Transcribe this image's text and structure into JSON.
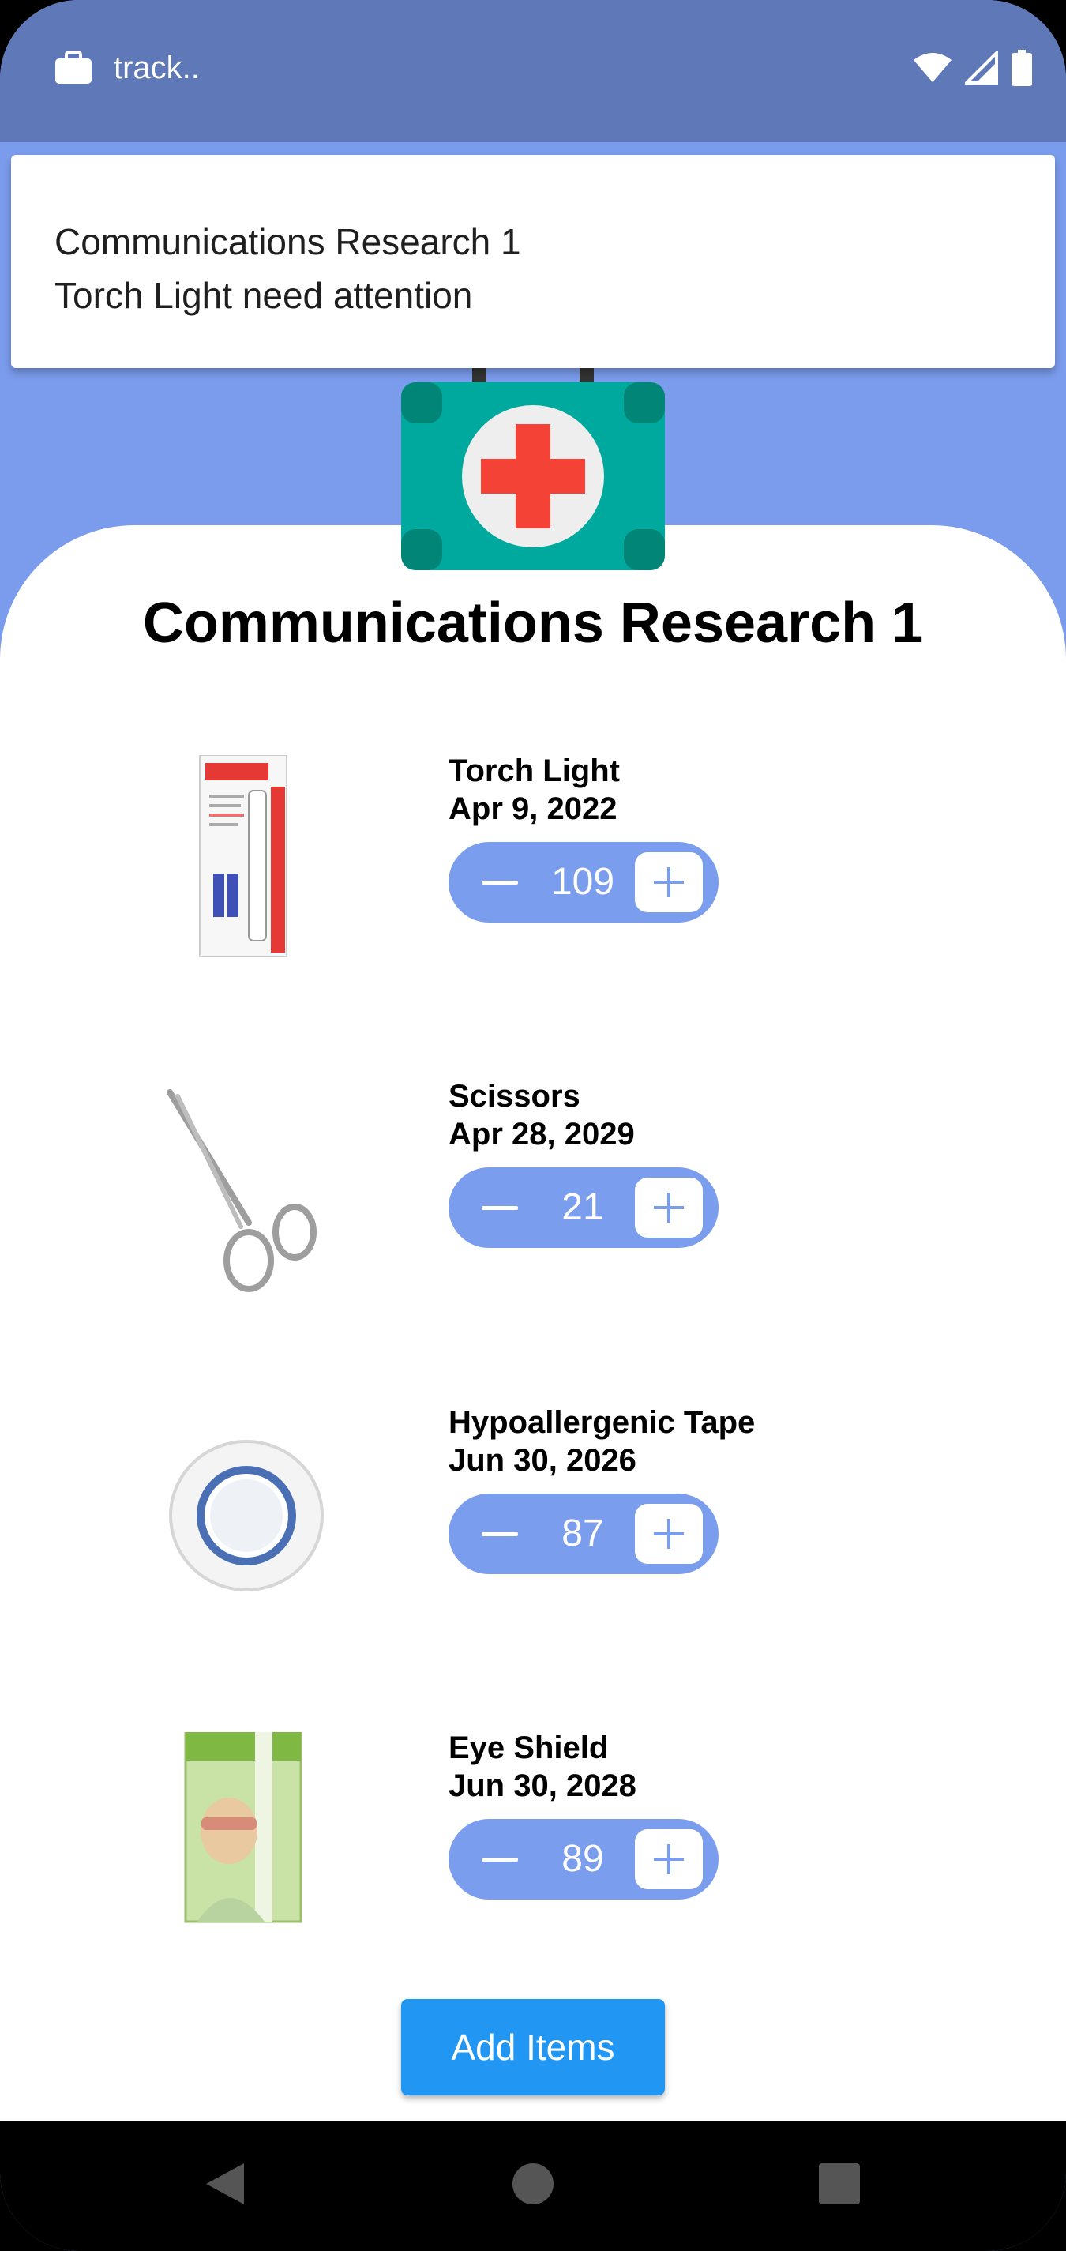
{
  "status_bar": {
    "app_label": "track.."
  },
  "notification": {
    "title": "Communications Research 1",
    "message": "Torch Light need attention"
  },
  "page": {
    "title": "Communications Research 1"
  },
  "items": [
    {
      "name": "Torch Light",
      "date": "Apr 9, 2022",
      "quantity": "109"
    },
    {
      "name": "Scissors",
      "date": "Apr 28, 2029",
      "quantity": "21"
    },
    {
      "name": "Hypoallergenic Tape",
      "date": "Jun 30, 2026",
      "quantity": "87"
    },
    {
      "name": "Eye Shield",
      "date": "Jun 30, 2028",
      "quantity": "89"
    }
  ],
  "add_button": {
    "label": "Add Items"
  },
  "colors": {
    "status_bar": "#5f78b7",
    "header_background": "#7b9cec",
    "stepper": "#7b9ded",
    "add_button": "#2196f3",
    "kit_teal": "#00a99d",
    "kit_cross": "#f44336"
  }
}
